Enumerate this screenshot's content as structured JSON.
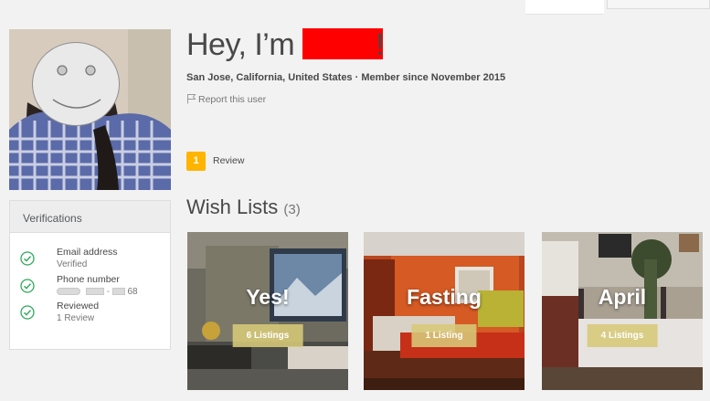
{
  "profile": {
    "greeting_prefix": "Hey, I’m",
    "greeting_suffix": "!",
    "location_line": "San Jose, California, United States · Member since November 2015",
    "report_link": "Report this user"
  },
  "reviews": {
    "count": "1",
    "label": "Review"
  },
  "verifications": {
    "title": "Verifications",
    "items": [
      {
        "title": "Email address",
        "status": "Verified"
      },
      {
        "title": "Phone number",
        "status_suffix": "68"
      },
      {
        "title": "Reviewed",
        "status": "1 Review"
      }
    ]
  },
  "wishlists": {
    "title": "Wish Lists",
    "count": "(3)",
    "cards": [
      {
        "name": "Yes!",
        "listings": "6 Listings"
      },
      {
        "name": "Fasting",
        "listings": "1 Listing"
      },
      {
        "name": "April",
        "listings": "4 Listings"
      }
    ]
  },
  "colors": {
    "review_badge": "#ffb400",
    "check": "#2faa5b",
    "redaction": "#ff0000",
    "pill": "#d7c878"
  },
  "icons": {
    "report": "flag-icon",
    "verification": "check-circle-icon"
  }
}
